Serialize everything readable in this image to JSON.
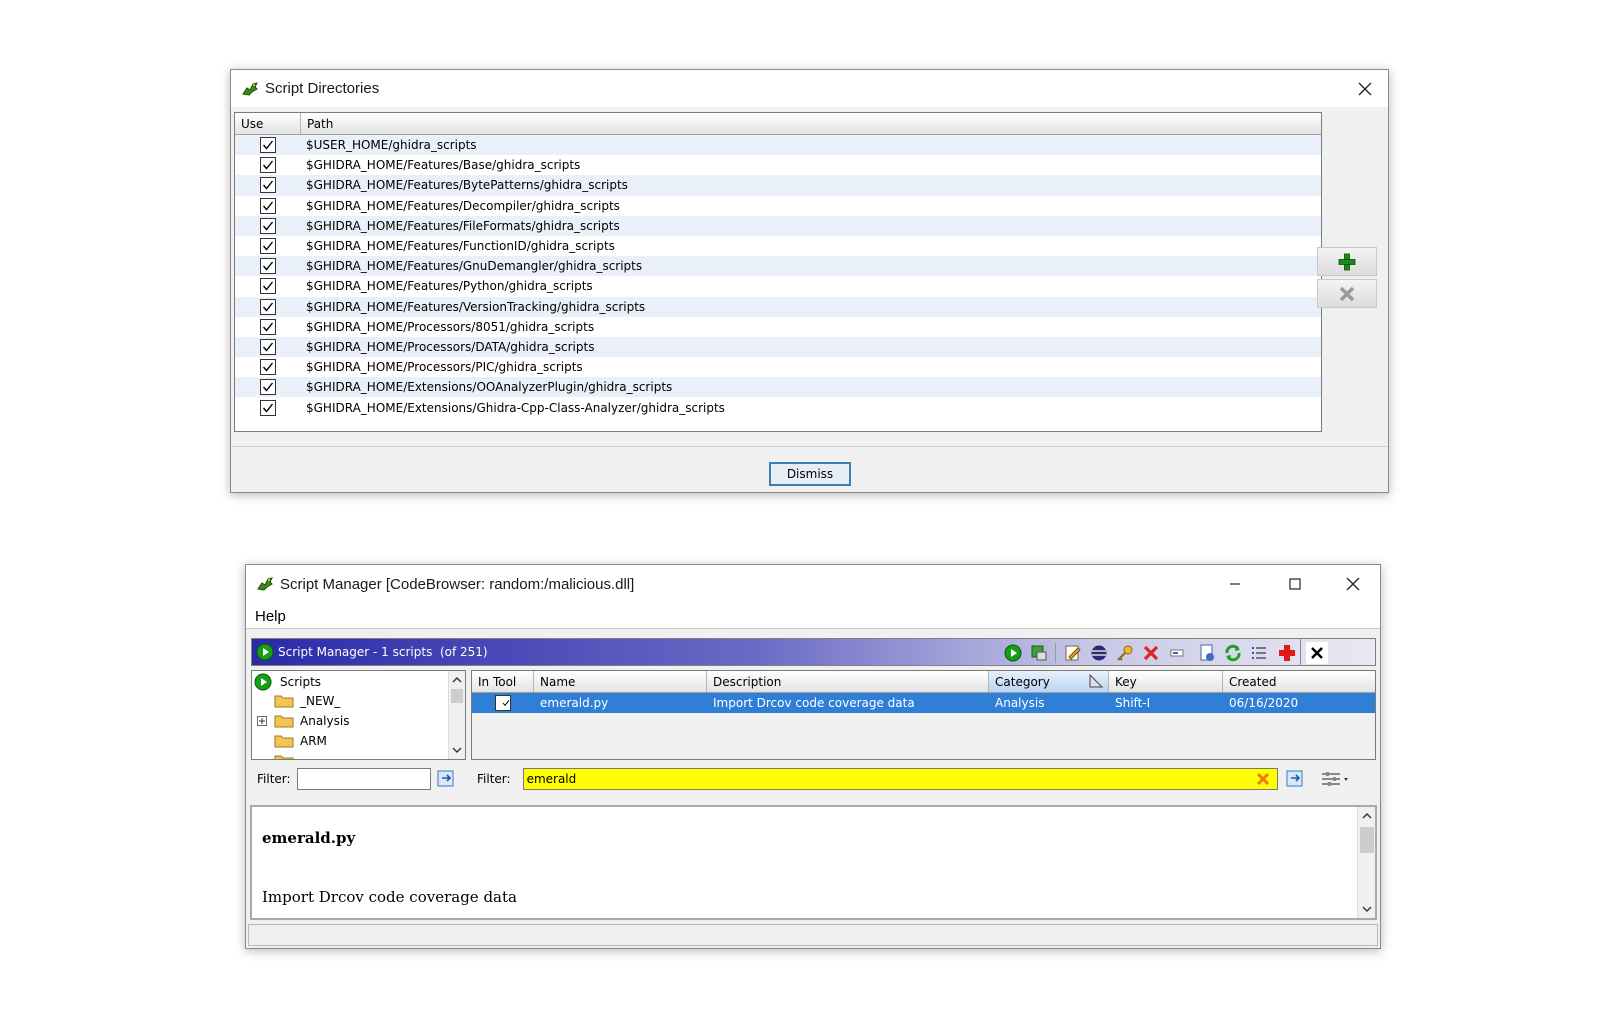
{
  "dir_dialog": {
    "title": "Script Directories",
    "columns": [
      "Use",
      "Path"
    ],
    "rows": [
      {
        "use": true,
        "path": "$USER_HOME/ghidra_scripts"
      },
      {
        "use": true,
        "path": "$GHIDRA_HOME/Features/Base/ghidra_scripts"
      },
      {
        "use": true,
        "path": "$GHIDRA_HOME/Features/BytePatterns/ghidra_scripts"
      },
      {
        "use": true,
        "path": "$GHIDRA_HOME/Features/Decompiler/ghidra_scripts"
      },
      {
        "use": true,
        "path": "$GHIDRA_HOME/Features/FileFormats/ghidra_scripts"
      },
      {
        "use": true,
        "path": "$GHIDRA_HOME/Features/FunctionID/ghidra_scripts"
      },
      {
        "use": true,
        "path": "$GHIDRA_HOME/Features/GnuDemangler/ghidra_scripts"
      },
      {
        "use": true,
        "path": "$GHIDRA_HOME/Features/Python/ghidra_scripts"
      },
      {
        "use": true,
        "path": "$GHIDRA_HOME/Features/VersionTracking/ghidra_scripts"
      },
      {
        "use": true,
        "path": "$GHIDRA_HOME/Processors/8051/ghidra_scripts"
      },
      {
        "use": true,
        "path": "$GHIDRA_HOME/Processors/DATA/ghidra_scripts"
      },
      {
        "use": true,
        "path": "$GHIDRA_HOME/Processors/PIC/ghidra_scripts"
      },
      {
        "use": true,
        "path": "$GHIDRA_HOME/Extensions/OOAnalyzerPlugin/ghidra_scripts"
      },
      {
        "use": true,
        "path": "$GHIDRA_HOME/Extensions/Ghidra-Cpp-Class-Analyzer/ghidra_scripts"
      }
    ],
    "dismiss_label": "Dismiss"
  },
  "script_manager": {
    "title": "Script Manager [CodeBrowser: random:/malicious.dll]",
    "menu": [
      "Help"
    ],
    "panel_title": "Script Manager - 1 scripts  (of 251)",
    "tree": {
      "root": "Scripts",
      "items": [
        "_NEW_",
        "Analysis",
        "ARM"
      ]
    },
    "tree_filter_label": "Filter:",
    "tree_filter_value": "",
    "table_columns": [
      "In Tool",
      "Name",
      "Description",
      "Category",
      "Key",
      "Created"
    ],
    "table_rows": [
      {
        "in_tool": true,
        "name": "emerald.py",
        "description": "Import Drcov code coverage data",
        "category": "Analysis",
        "key": "Shift-I",
        "created": "06/16/2020"
      }
    ],
    "table_filter_label": "Filter:",
    "table_filter_value": "emerald",
    "desc_title": "emerald.py",
    "desc_text": "Import Drcov code coverage data"
  },
  "colors": {
    "selection": "#2f7fd6",
    "filter_highlight": "#ffff00",
    "panel_header": "#2a2aa8"
  }
}
